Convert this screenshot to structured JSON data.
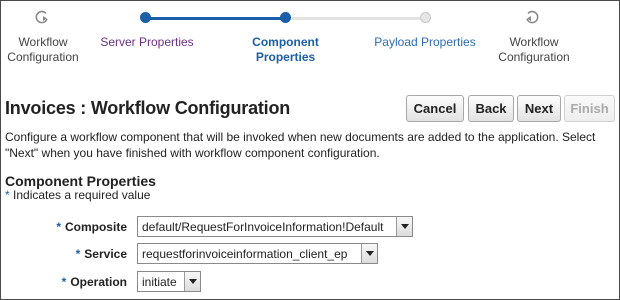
{
  "train": {
    "stops": [
      {
        "label": "Workflow Configuration",
        "state": "visited-end"
      },
      {
        "label": "Server Properties",
        "state": "visited"
      },
      {
        "label": "Component Properties",
        "state": "current"
      },
      {
        "label": "Payload Properties",
        "state": "next"
      },
      {
        "label": "Workflow Configuration",
        "state": "disabled-end"
      }
    ],
    "colors": {
      "active": "#1a5fa8",
      "idle": "#e6e6e6"
    }
  },
  "header": {
    "title": "Invoices : Workflow Configuration",
    "buttons": {
      "cancel": "Cancel",
      "back": "Back",
      "next": "Next",
      "finish": "Finish"
    }
  },
  "instructions": "Configure a workflow component that will be invoked when new documents are added to the application. Select \"Next\" when you have finished with workflow component configuration.",
  "form": {
    "section_title": "Component Properties",
    "required_star": "*",
    "required_note": "Indicates a required value",
    "fields": {
      "composite": {
        "label": "Composite",
        "value": "default/RequestForInvoiceInformation!Default"
      },
      "service": {
        "label": "Service",
        "value": "requestforinvoiceinformation_client_ep"
      },
      "operation": {
        "label": "Operation",
        "value": "initiate"
      }
    }
  }
}
